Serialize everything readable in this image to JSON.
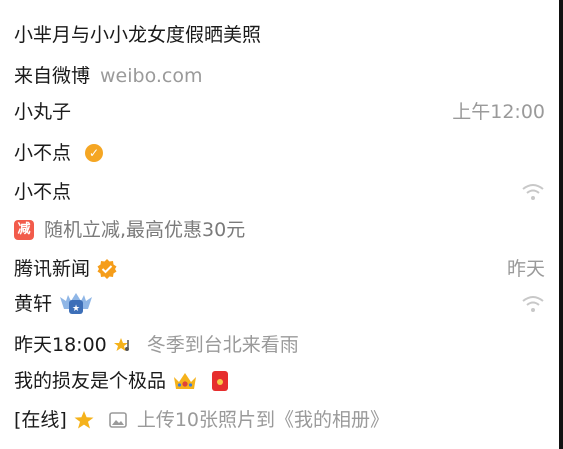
{
  "post": {
    "title": "小芈月与小小龙女度假晒美照",
    "source_prefix": "来自微博",
    "source_domain": "weibo.com"
  },
  "rows": [
    {
      "name": "小丸子",
      "right": "上午12:00"
    },
    {
      "name": "小不点"
    },
    {
      "name": "小不点"
    },
    {
      "promo": "随机立减,最高优惠30元",
      "promo_badge": "减"
    },
    {
      "name": "腾讯新闻",
      "right": "昨天"
    },
    {
      "name": "黄轩"
    },
    {
      "time": "昨天18:00",
      "status": "冬季到台北来看雨"
    },
    {
      "text": "我的损友是个极品"
    },
    {
      "online": "[在线]",
      "upload": "上传10张照片到《我的相册》"
    }
  ],
  "icons": {
    "verified": "verified-badge-icon",
    "wifi": "wifi-icon",
    "crown": "crown-icon",
    "red_packet": "red-packet-icon",
    "star": "star-icon",
    "image": "image-icon",
    "league": "league-badge-icon",
    "music_star": "music-star-icon"
  },
  "colors": {
    "muted": "#9a9a9a",
    "accent_orange": "#f5a623",
    "accent_red": "#f25b4b",
    "verify_orange": "#f59d1a"
  }
}
